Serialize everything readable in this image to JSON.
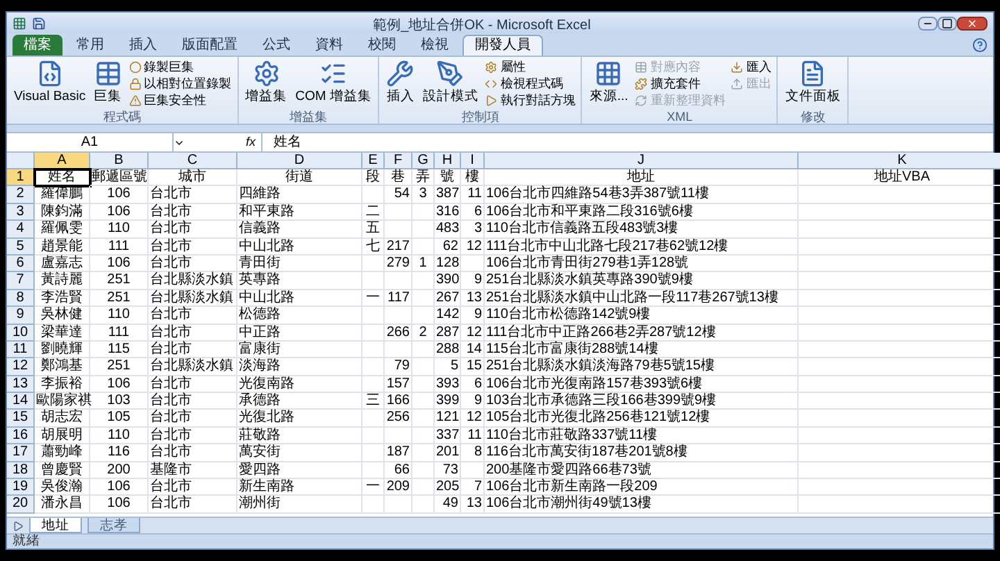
{
  "window": {
    "title": "範例_地址合併OK - Microsoft Excel"
  },
  "ribbon": {
    "tabs": [
      {
        "label": "檔案",
        "selected": false,
        "kind": "file"
      },
      {
        "label": "常用",
        "selected": false,
        "kind": "tab"
      },
      {
        "label": "插入",
        "selected": false,
        "kind": "tab"
      },
      {
        "label": "版面配置",
        "selected": false,
        "kind": "tab"
      },
      {
        "label": "公式",
        "selected": false,
        "kind": "tab"
      },
      {
        "label": "資料",
        "selected": false,
        "kind": "tab"
      },
      {
        "label": "校閱",
        "selected": false,
        "kind": "tab"
      },
      {
        "label": "檢視",
        "selected": false,
        "kind": "tab"
      },
      {
        "label": "開發人員",
        "selected": true,
        "kind": "tab"
      }
    ],
    "groups": [
      {
        "label": "程式碼",
        "items": [
          {
            "label": "Visual Basic",
            "kind": "large",
            "disabled": false
          },
          {
            "label": "巨集",
            "kind": "large",
            "disabled": false
          },
          {
            "label": "錄製巨集",
            "kind": "small",
            "disabled": false
          },
          {
            "label": "以相對位置錄製",
            "kind": "small",
            "disabled": false
          },
          {
            "label": "巨集安全性",
            "kind": "small",
            "disabled": false
          }
        ]
      },
      {
        "label": "增益集",
        "items": [
          {
            "label": "增益集",
            "kind": "large",
            "disabled": false
          },
          {
            "label": "COM 增益集",
            "kind": "large",
            "disabled": false
          }
        ]
      },
      {
        "label": "控制項",
        "items": [
          {
            "label": "插入",
            "kind": "large",
            "disabled": false
          },
          {
            "label": "設計模式",
            "kind": "large",
            "disabled": false
          },
          {
            "label": "屬性",
            "kind": "small",
            "disabled": false
          },
          {
            "label": "檢視程式碼",
            "kind": "small",
            "disabled": false
          },
          {
            "label": "執行對話方塊",
            "kind": "small",
            "disabled": false
          }
        ]
      },
      {
        "label": "XML",
        "items": [
          {
            "label": "來源...",
            "kind": "large",
            "disabled": false
          },
          {
            "label": "對應內容",
            "kind": "small",
            "disabled": true
          },
          {
            "label": "擴充套件",
            "kind": "small",
            "disabled": false
          },
          {
            "label": "重新整理資料",
            "kind": "small",
            "disabled": true
          },
          {
            "label": "匯入",
            "kind": "small",
            "disabled": false
          },
          {
            "label": "匯出",
            "kind": "small",
            "disabled": true
          }
        ]
      },
      {
        "label": "修改",
        "items": [
          {
            "label": "文件面板",
            "kind": "large",
            "disabled": false
          }
        ]
      }
    ]
  },
  "formula_bar": {
    "name_box": "A1",
    "fx": "fx",
    "formula": "姓名"
  },
  "sheet": {
    "columns": [
      {
        "label": "A",
        "selected": true
      },
      {
        "label": "B",
        "selected": false
      },
      {
        "label": "C",
        "selected": false
      },
      {
        "label": "D",
        "selected": false
      },
      {
        "label": "E",
        "selected": false
      },
      {
        "label": "F",
        "selected": false
      },
      {
        "label": "G",
        "selected": false
      },
      {
        "label": "H",
        "selected": false
      },
      {
        "label": "I",
        "selected": false
      },
      {
        "label": "J",
        "selected": false
      },
      {
        "label": "K",
        "selected": false
      }
    ],
    "rows": [
      {
        "number": "1",
        "selected": true,
        "cells": [
          "姓名",
          "郵遞區號",
          "城市",
          "街道",
          "段",
          "巷",
          "弄",
          "號",
          "樓",
          "地址",
          "地址VBA"
        ]
      },
      {
        "number": "2",
        "selected": false,
        "cells": [
          "羅偉鵬",
          "106",
          "台北市",
          "四維路",
          "",
          "54",
          "3",
          "387",
          "11",
          "106台北市四維路54巷3弄387號11樓",
          ""
        ]
      },
      {
        "number": "3",
        "selected": false,
        "cells": [
          "陳鈞滿",
          "106",
          "台北市",
          "和平東路",
          "二",
          "",
          "",
          "316",
          "6",
          "106台北市和平東路二段316號6樓",
          ""
        ]
      },
      {
        "number": "4",
        "selected": false,
        "cells": [
          "羅佩雯",
          "110",
          "台北市",
          "信義路",
          "五",
          "",
          "",
          "483",
          "3",
          "110台北市信義路五段483號3樓",
          ""
        ]
      },
      {
        "number": "5",
        "selected": false,
        "cells": [
          "趙景能",
          "111",
          "台北市",
          "中山北路",
          "七",
          "217",
          "",
          "62",
          "12",
          "111台北市中山北路七段217巷62號12樓",
          ""
        ]
      },
      {
        "number": "6",
        "selected": false,
        "cells": [
          "盧嘉志",
          "106",
          "台北市",
          "青田街",
          "",
          "279",
          "1",
          "128",
          "",
          "106台北市青田街279巷1弄128號",
          ""
        ]
      },
      {
        "number": "7",
        "selected": false,
        "cells": [
          "黃詩麗",
          "251",
          "台北縣淡水鎮",
          "英專路",
          "",
          "",
          "",
          "390",
          "9",
          "251台北縣淡水鎮英專路390號9樓",
          ""
        ]
      },
      {
        "number": "8",
        "selected": false,
        "cells": [
          "李浩賢",
          "251",
          "台北縣淡水鎮",
          "中山北路",
          "一",
          "117",
          "",
          "267",
          "13",
          "251台北縣淡水鎮中山北路一段117巷267號13樓",
          ""
        ]
      },
      {
        "number": "9",
        "selected": false,
        "cells": [
          "吳林健",
          "110",
          "台北市",
          "松德路",
          "",
          "",
          "",
          "142",
          "9",
          "110台北市松德路142號9樓",
          ""
        ]
      },
      {
        "number": "10",
        "selected": false,
        "cells": [
          "梁華達",
          "111",
          "台北市",
          "中正路",
          "",
          "266",
          "2",
          "287",
          "12",
          "111台北市中正路266巷2弄287號12樓",
          ""
        ]
      },
      {
        "number": "11",
        "selected": false,
        "cells": [
          "劉曉輝",
          "115",
          "台北市",
          "富康街",
          "",
          "",
          "",
          "288",
          "14",
          "115台北市富康街288號14樓",
          ""
        ]
      },
      {
        "number": "12",
        "selected": false,
        "cells": [
          "鄭鴻基",
          "251",
          "台北縣淡水鎮",
          "淡海路",
          "",
          "79",
          "",
          "5",
          "15",
          "251台北縣淡水鎮淡海路79巷5號15樓",
          ""
        ]
      },
      {
        "number": "13",
        "selected": false,
        "cells": [
          "李振裕",
          "106",
          "台北市",
          "光復南路",
          "",
          "157",
          "",
          "393",
          "6",
          "106台北市光復南路157巷393號6樓",
          ""
        ]
      },
      {
        "number": "14",
        "selected": false,
        "cells": [
          "歐陽家祺",
          "103",
          "台北市",
          "承德路",
          "三",
          "166",
          "",
          "399",
          "9",
          "103台北市承德路三段166巷399號9樓",
          ""
        ]
      },
      {
        "number": "15",
        "selected": false,
        "cells": [
          "胡志宏",
          "105",
          "台北市",
          "光復北路",
          "",
          "256",
          "",
          "121",
          "12",
          "105台北市光復北路256巷121號12樓",
          ""
        ]
      },
      {
        "number": "16",
        "selected": false,
        "cells": [
          "胡展明",
          "110",
          "台北市",
          "莊敬路",
          "",
          "",
          "",
          "337",
          "11",
          "110台北市莊敬路337號11樓",
          ""
        ]
      },
      {
        "number": "17",
        "selected": false,
        "cells": [
          "蕭勁峰",
          "116",
          "台北市",
          "萬安街",
          "",
          "187",
          "",
          "201",
          "8",
          "116台北市萬安街187巷201號8樓",
          ""
        ]
      },
      {
        "number": "18",
        "selected": false,
        "cells": [
          "曾慶賢",
          "200",
          "基隆市",
          "愛四路",
          "",
          "66",
          "",
          "73",
          "",
          "200基隆市愛四路66巷73號",
          ""
        ]
      },
      {
        "number": "19",
        "selected": false,
        "cells": [
          "吳俊瀚",
          "106",
          "台北市",
          "新生南路",
          "一",
          "209",
          "",
          "205",
          "7",
          "106台北市新生南路一段209",
          ""
        ]
      },
      {
        "number": "20",
        "selected": false,
        "cells": [
          "潘永昌",
          "106",
          "台北市",
          "潮州街",
          "",
          "",
          "",
          "49",
          "13",
          "106台北市潮州街49號13樓",
          ""
        ]
      }
    ]
  },
  "sheet_tabs": [
    {
      "label": "地址",
      "selected": true
    },
    {
      "label": "志孝",
      "selected": false
    }
  ],
  "status_bar": {
    "text": "就緒"
  }
}
